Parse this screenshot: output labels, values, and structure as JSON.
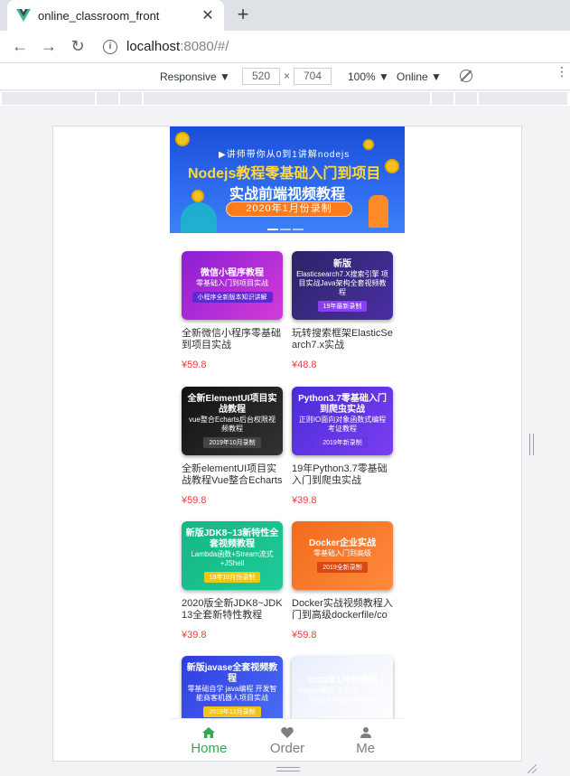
{
  "browser": {
    "tab_title": "online_classroom_front",
    "tab_close": "✕",
    "new_tab": "+",
    "url_host": "localhost",
    "url_rest": ":8080/#/",
    "nav": {
      "back": "←",
      "forward": "→",
      "reload": "↻"
    }
  },
  "devtools": {
    "device": "Responsive ▼",
    "width": "520",
    "height": "704",
    "times": "×",
    "zoom": "100% ▼",
    "network": "Online ▼",
    "more": "⋮"
  },
  "banner": {
    "subtitle": "▶讲师带你从0到1讲解nodejs",
    "title_line1": "Nodejs教程零基础入门到项目",
    "title_line2": "实战前端视频教程",
    "pill": "2020年1月份录制",
    "slides": 3,
    "active_slide": 1
  },
  "courses": [
    {
      "thumb_line1": "微信小程序教程",
      "thumb_line2": "零基础入门到项目实战",
      "thumb_badge": "小程序全新版本知识讲解",
      "title": "全新微信小程序零基础到项目实战",
      "price": "¥59.8",
      "bg": "linear-gradient(135deg,#8a1fd4,#d43bd8)",
      "badge_bg": "#5b2bd1"
    },
    {
      "thumb_line1": "新版",
      "thumb_line2": "Elasticsearch7.X搜索引擎 项目实战Java架构全套视频教程",
      "thumb_badge": "19年最新录制",
      "title": "玩转搜索框架ElasticSearch7.x实战",
      "price": "¥48.8",
      "bg": "linear-gradient(135deg,#2a2466,#4b2fa3)",
      "badge_bg": "#8a3ff0"
    },
    {
      "thumb_line1": "全新ElementUI项目实战教程",
      "thumb_line2": "vue整合Echarts后台权限视频教程",
      "thumb_badge": "2019年10月录制",
      "title": "全新elementUI项目实战教程Vue整合Echarts",
      "price": "¥59.8",
      "bg": "linear-gradient(135deg,#111,#333)",
      "badge_bg": "#444"
    },
    {
      "thumb_line1": "Python3.7零基础入门到爬虫实战",
      "thumb_line2": "正则IO面向对象函数式编程考证教程",
      "thumb_badge": "2019年新录制",
      "title": "19年Python3.7零基础入门到爬虫实战",
      "price": "¥39.8",
      "bg": "linear-gradient(135deg,#4a2bd8,#7a3ff0)",
      "badge_bg": "#6a35e6"
    },
    {
      "thumb_line1": "新版JDK8~13新特性全套视频教程",
      "thumb_line2": "Lambda函数+Stream流式+JShell",
      "thumb_badge": "19年10月份录制",
      "title": "2020版全新JDK8~JDK13全套新特性教程",
      "price": "¥39.8",
      "bg": "linear-gradient(135deg,#12b886,#20c997)",
      "badge_bg": "#f0c419"
    },
    {
      "thumb_line1": "Docker企业实战",
      "thumb_line2": "零基础入门到高级",
      "thumb_badge": "2019全新录制",
      "title": "Docker实战视频教程入门到高级dockerfile/compose",
      "price": "¥59.8",
      "bg": "linear-gradient(135deg,#f26b1d,#ff8a3d)",
      "badge_bg": "#d9480f"
    },
    {
      "thumb_line1": "新版javase全套视频教程",
      "thumb_line2": "零基础自学 java编程 开发智能商客机器人项目实战",
      "thumb_badge": "2019年12月录制",
      "title": "",
      "price": "",
      "bg": "linear-gradient(135deg,#2f3be0,#4c6ef5)",
      "badge_bg": "#f0c419"
    },
    {
      "thumb_line1": "2020年1月份录制",
      "thumb_line2": "Nodejs教程 零基础入门到项目实战 前端视频教程",
      "thumb_badge": "",
      "title": "",
      "price": "",
      "bg": "linear-gradient(135deg,#e8eefc,#ffffff)",
      "badge_bg": "#f08c00"
    }
  ],
  "tabbar": {
    "items": [
      {
        "label": "Home",
        "icon": "home-icon",
        "active": true
      },
      {
        "label": "Order",
        "icon": "heart-icon",
        "active": false
      },
      {
        "label": "Me",
        "icon": "user-icon",
        "active": false
      }
    ],
    "active_color": "#35a94f",
    "inactive_color": "#7d7e80"
  }
}
